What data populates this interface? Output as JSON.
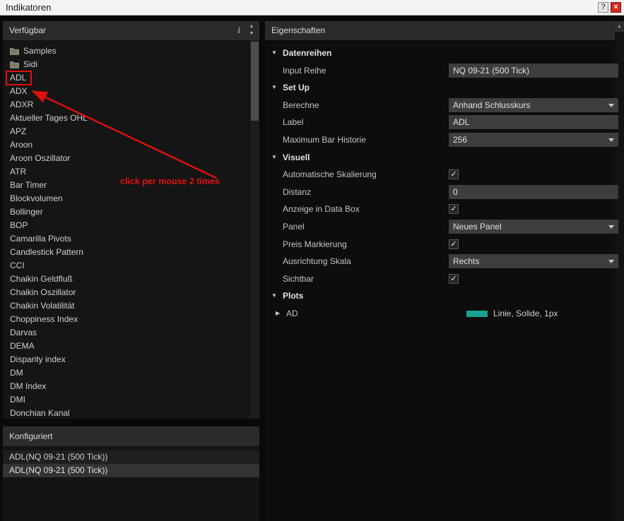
{
  "window": {
    "title": "Indikatoren",
    "help_label": "?",
    "close_label": "×"
  },
  "icons": {
    "check": "✓",
    "down_triangle": "▼",
    "right_triangle": "▶",
    "up_triangle": "▲",
    "info": "i"
  },
  "colors": {
    "annotation_red": "#e01010",
    "plot_swatch_teal": "#18a392"
  },
  "annotation": {
    "text": "click per mouse 2 times"
  },
  "available": {
    "header": "Verfügbar",
    "items": [
      "Samples",
      "Sidi",
      "ADL",
      "ADX",
      "ADXR",
      "Aktueller Tages OHL",
      "APZ",
      "Aroon",
      "Aroon Oszillator",
      "ATR",
      "Bar Timer",
      "Blockvolumen",
      "Bollinger",
      "BOP",
      "Camarilla Pivots",
      "Candlestick Pattern",
      "CCI",
      "Chaikin Geldfluß",
      "Chaikin Oszillator",
      "Chaikin Volatilität",
      "Choppiness Index",
      "Darvas",
      "DEMA",
      "Disparity index",
      "DM",
      "DM Index",
      "DMI",
      "Donchian Kanal"
    ]
  },
  "configured": {
    "header": "Konfiguriert",
    "items": [
      "ADL(NQ 09-21 (500 Tick))",
      "ADL(NQ 09-21 (500 Tick))"
    ]
  },
  "properties": {
    "header": "Eigenschaften",
    "groups": [
      "Datenreihen",
      "Set Up",
      "Visuell",
      "Plots"
    ],
    "fields": {
      "input_reihe": {
        "label": "Input Reihe",
        "value": "NQ 09-21 (500 Tick)"
      },
      "berechne": {
        "label": "Berechne",
        "value": "Anhand Schlusskurs"
      },
      "label": {
        "label": "Label",
        "value": "ADL"
      },
      "maximum_bar_historie": {
        "label": "Maximum Bar Historie",
        "value": "256"
      },
      "automatische_skalierung": {
        "label": "Automatische Skalierung",
        "checked": true
      },
      "distanz": {
        "label": "Distanz",
        "value": "0"
      },
      "anzeige_in_data_box": {
        "label": "Anzeige in Data Box",
        "checked": true
      },
      "panel": {
        "label": "Panel",
        "value": "Neues Panel"
      },
      "preis_markierung": {
        "label": "Preis Markierung",
        "checked": true
      },
      "ausrichtung_skala": {
        "label": "Ausrichtung Skala",
        "value": "Rechts"
      },
      "sichtbar": {
        "label": "Sichtbar",
        "checked": true
      },
      "plot_ad": {
        "label": "AD",
        "style": "Linie, Solide, 1px"
      }
    }
  }
}
